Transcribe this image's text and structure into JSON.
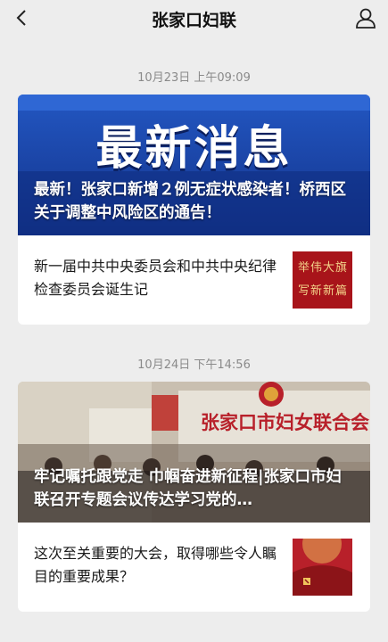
{
  "header": {
    "title": "张家口妇联",
    "back_icon": "chevron-left-icon",
    "profile_icon": "person-icon"
  },
  "messages": [
    {
      "timestamp": "10月23日 上午09:09",
      "hero": {
        "banner_text": "最新消息",
        "caption": "最新！张家口新增２例无症状感染者！桥西区关于调整中风险区的通告！"
      },
      "sub_article": {
        "title": "新一届中共中央委员会和中共中央纪律检查委员会诞生记",
        "thumb_text": "举伟大旗写新新篇"
      }
    },
    {
      "timestamp": "10月24日 下午14:56",
      "hero": {
        "sign_text": "张家口市妇女联合会",
        "caption": "牢记嘱托跟党走 巾帼奋进新征程|张家口市妇联召开专题会议传达学习党的…"
      },
      "sub_article": {
        "title": "这次至关重要的大会，取得哪些令人瞩目的重要成果？"
      }
    }
  ],
  "colors": {
    "background": "#ededed",
    "banner_blue": "#1a3f9c",
    "emblem_red": "#b8202a"
  }
}
